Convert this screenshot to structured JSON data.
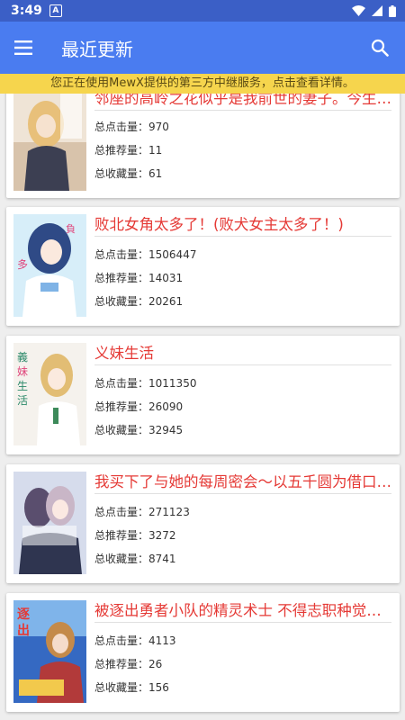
{
  "status_bar": {
    "time": "3:49",
    "notif_letter": "A"
  },
  "app_bar": {
    "title": "最近更新"
  },
  "banner": {
    "text": "您正在使用MewX提供的第三方中继服务，点击查看详情。"
  },
  "stat_labels": {
    "clicks": "总点击量：",
    "recommends": "总推荐量：",
    "favorites": "总收藏量："
  },
  "novels": [
    {
      "title": "邻座的高岭之花似乎是我前世的妻子。今生也想……",
      "clicks": "970",
      "recommends": "11",
      "favorites": "61",
      "cover_colors": [
        "#e8d9c8",
        "#f3e9dd",
        "#c9a98b"
      ]
    },
    {
      "title": "败北女角太多了！(败犬女主太多了！)",
      "clicks": "1506447",
      "recommends": "14031",
      "favorites": "20261",
      "cover_colors": [
        "#bfe3f5",
        "#f9f0f4",
        "#3f5f9f"
      ]
    },
    {
      "title": "义妹生活",
      "clicks": "1011350",
      "recommends": "26090",
      "favorites": "32945",
      "cover_colors": [
        "#f4f1ec",
        "#e9dfd0",
        "#d5b27b"
      ]
    },
    {
      "title": "我买下了与她的每周密会～以五千圆为借口……",
      "clicks": "271123",
      "recommends": "3272",
      "favorites": "8741",
      "cover_colors": [
        "#cfd8ea",
        "#8f8ba8",
        "#e7c9cf"
      ]
    },
    {
      "title": "被逐出勇者小队的精灵术士 不得志职种觉醒……",
      "clicks": "4113",
      "recommends": "26",
      "favorites": "156",
      "cover_colors": [
        "#2a5fb8",
        "#c43b3b",
        "#f2c94c"
      ]
    }
  ]
}
